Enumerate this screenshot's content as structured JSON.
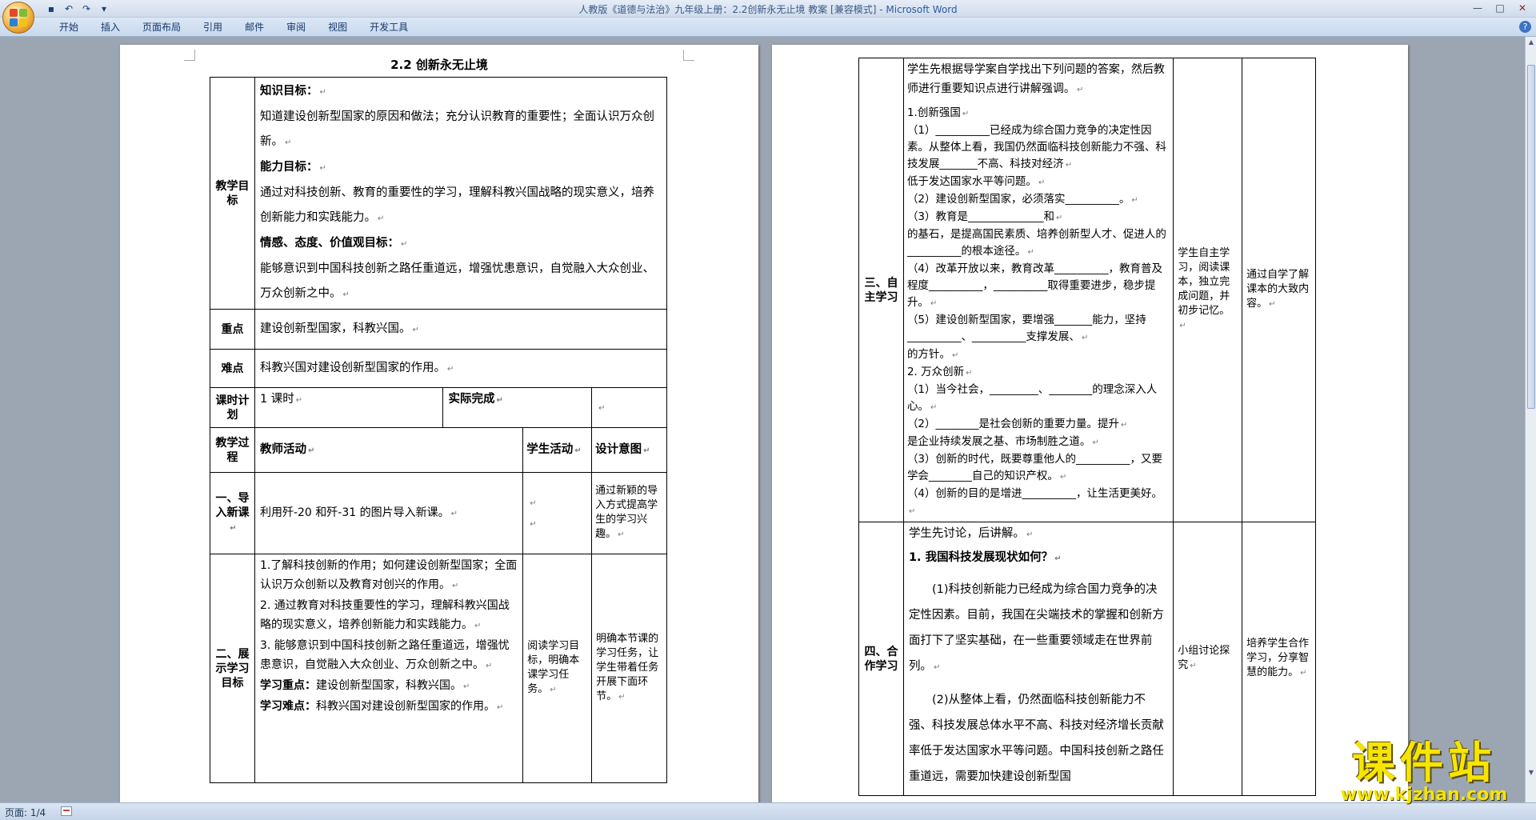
{
  "window": {
    "title_doc": "人教版《道德与法治》九年级上册：2.2创新永无止境 教案 [兼容模式] - ",
    "title_app": "Microsoft Word"
  },
  "quick_access": [
    "save-icon",
    "undo-icon",
    "redo-icon",
    "customize-icon"
  ],
  "ribbon_tabs": [
    "开始",
    "插入",
    "页面布局",
    "引用",
    "邮件",
    "审阅",
    "视图",
    "开发工具"
  ],
  "help_label": "?",
  "status": {
    "page": "页面: 1/4"
  },
  "mark": "↵",
  "page1": {
    "heading": "2.2   创新永无止境",
    "goals_label": "教学目标",
    "knowledge_title": "知识目标：",
    "knowledge_text": "知道建设创新型国家的原因和做法；充分认识教育的重要性；全面认识万众创新。",
    "ability_title": "能力目标：",
    "ability_text": "通过对科技创新、教育的重要性的学习，理解科教兴国战略的现实意义，培养创新能力和实践能力。",
    "emotion_title": "情感、态度、价值观目标：",
    "emotion_text": "能够意识到中国科技创新之路任重道远，增强忧患意识，自觉融入大众创业、万众创新之中。",
    "key_label": "重点",
    "key_text": "建设创新型国家，科教兴国。",
    "difficult_label": "难点",
    "difficult_text": "科教兴国对建设创新型国家的作用。",
    "plan_label": "课时计划",
    "plan_value": "1 课时",
    "actual_label": "实际完成",
    "process_label": "教学过程",
    "teacher_header": "教师活动",
    "student_header": "学生活动",
    "design_header": "设计意图",
    "s1_label": "一、导入新课",
    "s1_teacher": "利用歼-20 和歼-31 的图片导入新课。",
    "s1_design": "通过新颖的导入方式提高学生的学习兴趣。",
    "s2_label": "二、展示学习目标",
    "s2_t1": "1.了解科技创新的作用；如何建设创新型国家；全面认识万众创新以及教育对创兴的作用。",
    "s2_t2": "2. 通过教育对科技重要性的学习，理解科教兴国战略的现实意义，培养创新能力和实践能力。",
    "s2_t3": "3. 能够意识到中国科技创新之路任重道远，增强忧患意识，自觉融入大众创业、万众创新之中。",
    "s2_key_title": "学习重点：",
    "s2_key_text": "建设创新型国家，科教兴国。",
    "s2_diff_title": "学习难点：",
    "s2_diff_text": "科教兴国对建设创新型国家的作用。",
    "s2_student": "阅读学习目标，明确本课学习任务。",
    "s2_design": "明确本节课的学习任务，让学生带着任务开展下面环节。"
  },
  "page2": {
    "s3_label": "三、自主学习",
    "s3_intro": "学生先根据导学案自学找出下列问题的答案，然后教师进行重要知识点进行讲解强调。",
    "s3_lines": [
      "1.创新强国",
      "（1）__________已经成为综合国力竞争的决定性因素。从整体上看，我国仍然面临科技创新能力不强、科技发展_______不高、科技对经济",
      "低于发达国家水平等问题。",
      "（2）建设创新型国家，必须落实__________。",
      "（3）教育是______________和",
      "的基石，是提高国民素质、培养创新型人才、促进人的__________的根本途径。",
      "（4）改革开放以来，教育改革__________，教育普及程度__________，__________取得重要进步，稳步提升。",
      "（5）建设创新型国家，要增强_______能力，坚持__________、__________支撑发展、",
      "的方针。",
      "2. 万众创新",
      "（1）当今社会，_________、________的理念深入人心。",
      "（2）________是社会创新的重要力量。提升",
      "是企业持续发展之基、市场制胜之道。",
      "（3）创新的时代，既要尊重他人的__________，又要学会________自己的知识产权。",
      "（4）创新的目的是增进__________，让生活更美好。"
    ],
    "s3_student": "学生自主学习，阅读课本，独立完成问题，并初步记忆。",
    "s3_design": "通过自学了解课本的大致内容。",
    "s4_label": "四、合作学习",
    "s4_intro": "学生先讨论，后讲解。",
    "s4_q1": "1. 我国科技发展现状如何？",
    "s4_p1": "(1)科技创新能力已经成为综合国力竞争的决定性因素。目前，我国在尖端技术的掌握和创新方面打下了坚实基础，在一些重要领域走在世界前列。",
    "s4_p2": "(2)从整体上看，仍然面临科技创新能力不强、科技发展总体水平不高、科技对经济增长贡献率低于发达国家水平等问题。中国科技创新之路任重道远，需要加快建设创新型国",
    "s4_student": "小组讨论探究",
    "s4_design": "培养学生合作学习，分享智慧的能力。"
  },
  "watermark": {
    "cn": "课件站",
    "url": "www.kjzhan.com"
  },
  "colors": {
    "brand_yellow": "#f6e500",
    "page_bg": "#9ca6b3"
  }
}
